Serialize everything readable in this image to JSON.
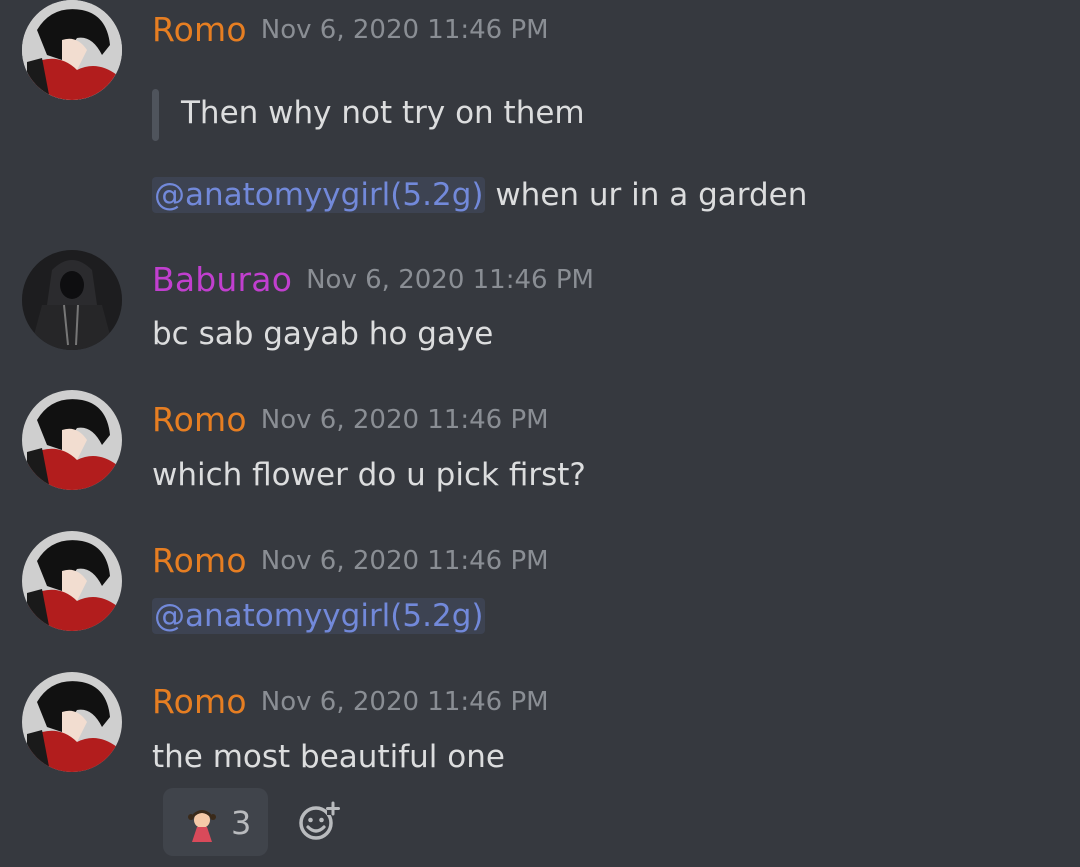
{
  "colors": {
    "background": "#36393f",
    "romo": "#e67e22",
    "baburao": "#c13fcf",
    "mention": "#7289da",
    "text": "#dcddde",
    "timestamp": "#8a8e94"
  },
  "messages": [
    {
      "author": "Romo",
      "timestamp": "Nov 6, 2020 11:46 PM",
      "avatar_icon": "anime-avatar-red-jacket",
      "quote": "Then why not try on them",
      "mention": "@anatomyygirl(5.2g)",
      "text": " when ur in a garden"
    },
    {
      "author": "Baburao",
      "timestamp": "Nov 6, 2020 11:46 PM",
      "avatar_icon": "dark-hooded-figure-avatar",
      "text": "bc sab gayab ho gaye"
    },
    {
      "author": "Romo",
      "timestamp": "Nov 6, 2020 11:46 PM",
      "avatar_icon": "anime-avatar-red-jacket",
      "text": "which flower do u pick first?"
    },
    {
      "author": "Romo",
      "timestamp": "Nov 6, 2020 11:46 PM",
      "avatar_icon": "anime-avatar-red-jacket",
      "mention": "@anatomyygirl(5.2g)"
    },
    {
      "author": "Romo",
      "timestamp": "Nov 6, 2020 11:46 PM",
      "avatar_icon": "anime-avatar-red-jacket",
      "text": "the most beautiful one"
    }
  ],
  "reaction": {
    "emoji_icon": "girl-emoji-icon",
    "count": "3",
    "add_reaction_icon": "add-reaction-smiley-icon"
  }
}
